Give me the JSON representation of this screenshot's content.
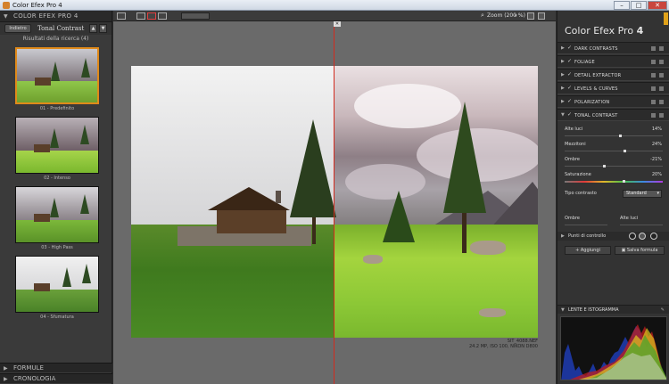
{
  "window": {
    "title": "Color Efex Pro 4",
    "minimize": "–",
    "maximize": "□",
    "close": "✕"
  },
  "left_panel": {
    "header": "COLOR EFEX PRO 4",
    "back_button": "Indietro",
    "tab_name": "Tonal Contrast",
    "nav_up": "▲",
    "nav_down": "▼",
    "results_title": "Risultati della ricerca (4)",
    "thumbnails": [
      {
        "label": "01 - Predefinito",
        "selected": true
      },
      {
        "label": "02 - Intenso",
        "selected": false
      },
      {
        "label": "03 - High Pass",
        "selected": false
      },
      {
        "label": "04 - Sfumatura",
        "selected": false
      }
    ],
    "footer_formule": "FORMULE",
    "footer_cronologia": "CRONOLOGIA"
  },
  "toolbar": {
    "zoom_label": "Zoom (200 %)",
    "zoom_caret": "▾"
  },
  "image": {
    "filename": "SIT_4088.NEF",
    "meta": "24.2 MP, ISO 100, NIKON D800"
  },
  "right_panel": {
    "brand_text": "Color Efex Pro",
    "brand_version": "4",
    "filters": [
      {
        "name": "DARK CONTRASTS",
        "checked": true,
        "expanded": false
      },
      {
        "name": "FOLIAGE",
        "checked": true,
        "expanded": false
      },
      {
        "name": "DETAIL EXTRACTOR",
        "checked": true,
        "expanded": false
      },
      {
        "name": "LEVELS & CURVES",
        "checked": true,
        "expanded": false
      },
      {
        "name": "POLARIZATION",
        "checked": true,
        "expanded": false
      },
      {
        "name": "TONAL CONTRAST",
        "checked": true,
        "expanded": true
      }
    ],
    "sliders": [
      {
        "label": "Alte luci",
        "value": "14%"
      },
      {
        "label": "Mezzitoni",
        "value": "24%"
      },
      {
        "label": "Ombre",
        "value": "-21%"
      },
      {
        "label": "Saturazione",
        "value": "20%"
      }
    ],
    "contrast_type_label": "Tipo contrasto",
    "contrast_type_value": "Standard",
    "shadows_label": "Ombre",
    "highlights_label": "Alte luci",
    "control_points_label": "Punti di controllo",
    "add_button": "Aggiungi",
    "save_recipe_button": "Salva formula",
    "histogram_header": "LENTE E ISTOGRAMMA",
    "colors": {
      "accent": "#e08a1a",
      "split_line": "#d12b1f"
    }
  }
}
